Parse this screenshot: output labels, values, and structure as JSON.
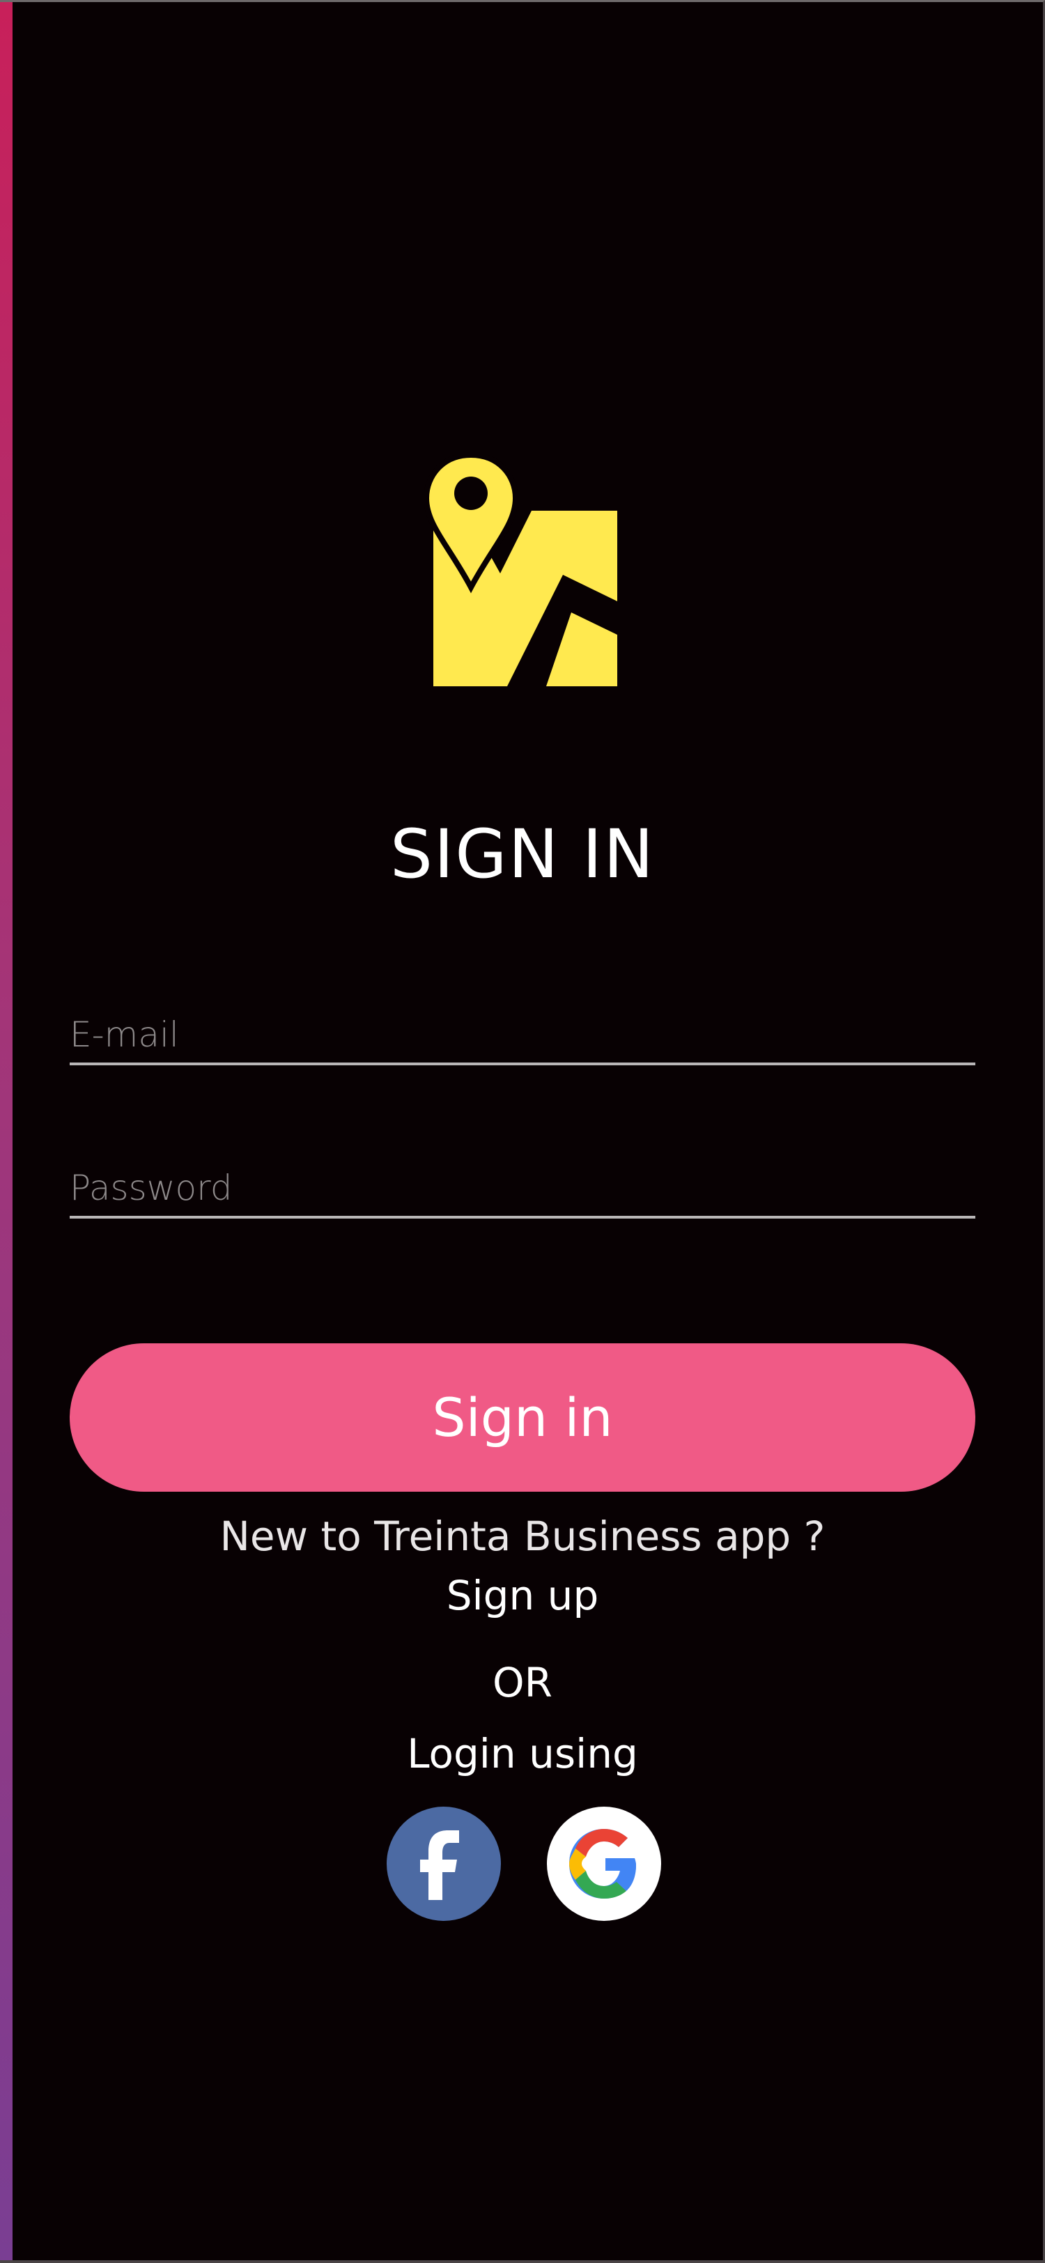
{
  "brand": {
    "logo_icon": "map-pin-icon",
    "logo_color": "#ffe94f"
  },
  "title": "SIGN IN",
  "form": {
    "email_placeholder": "E-mail",
    "email_value": "",
    "password_placeholder": "Password",
    "password_value": ""
  },
  "actions": {
    "signin_label": "Sign in",
    "signin_color": "#f05a86",
    "new_to_text": "New to Treinta Business  app ?",
    "signup_label": "Sign up",
    "or_text": "OR",
    "login_using_text": "Login using"
  },
  "social": [
    {
      "name": "facebook",
      "icon": "facebook-icon",
      "color": "#4c6aa3"
    },
    {
      "name": "google",
      "icon": "google-icon",
      "color": "#ffffff"
    }
  ]
}
